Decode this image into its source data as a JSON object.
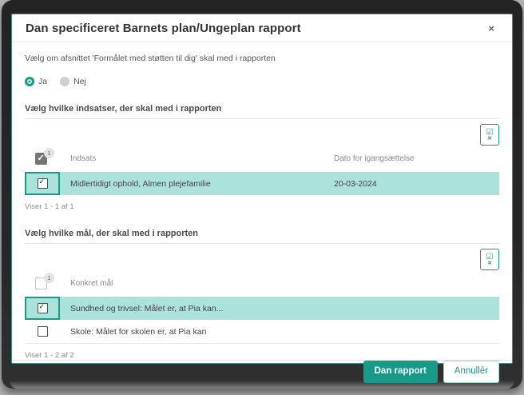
{
  "colors": {
    "accent_teal": "#179b88",
    "row_highlight": "#abe2da",
    "header_checkbox_gray": "#757575"
  },
  "modal": {
    "title": "Dan specificeret Barnets plan/Ungeplan rapport",
    "close_icon": "×",
    "intro": "Vælg om afsnittet 'Formålet med støtten til dig' skal med i rapporten",
    "radio_yes_label": "Ja",
    "radio_yes_checked": true,
    "radio_no_label": "Nej",
    "radio_no_checked": false
  },
  "indsatser": {
    "label": "Vælg hvilke indsatser, der skal med i rapporten",
    "selectall_check_glyph": "☑",
    "selectall_x_glyph": "✕",
    "header_checkbox_checked": true,
    "header_badge": "1",
    "columns": [
      "Indsats",
      "Dato for igangsættelse"
    ],
    "rows": [
      {
        "name": "Midlertidigt ophold, Almen plejefamilie",
        "date": "20-03-2024",
        "checked": true
      }
    ],
    "pager": "Viser 1 - 1 af 1"
  },
  "maal": {
    "label": "Vælg hvilke mål, der skal med i rapporten",
    "selectall_check_glyph": "☑",
    "selectall_x_glyph": "✕",
    "header_checkbox_checked": false,
    "header_badge": "1",
    "columns": [
      "Konkret mål"
    ],
    "rows": [
      {
        "name": "Sundhed og trivsel: Målet er, at Pia kan...",
        "checked": true
      },
      {
        "name": "Skole: Målet for skolen er, at Pia kan",
        "checked": false
      }
    ],
    "pager": "Viser 1 - 2 af 2"
  },
  "footer": {
    "primary_label": "Dan rapport",
    "secondary_label": "Annullér"
  }
}
